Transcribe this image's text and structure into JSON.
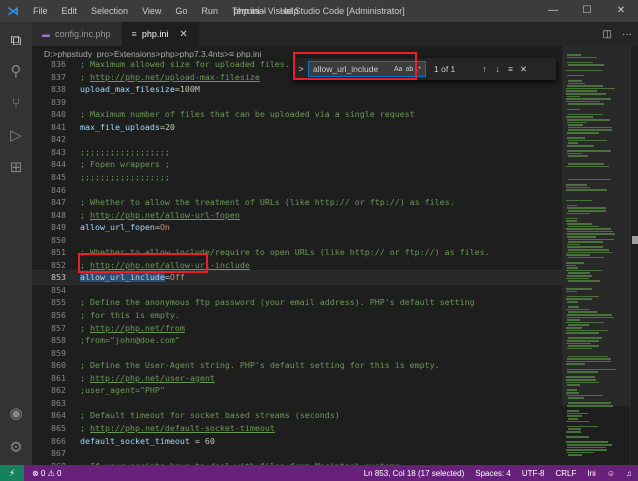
{
  "titlebar": {
    "logo": "⋊",
    "menu": [
      "File",
      "Edit",
      "Selection",
      "View",
      "Go",
      "Run",
      "Terminal",
      "Help"
    ],
    "title": "php.ini - Visual Studio Code [Administrator]",
    "minimize": "—",
    "maximize": "☐",
    "close": "✕"
  },
  "activity": {
    "explorer_icon": "⧉",
    "search_icon": "⚲",
    "scm_icon": "⑂",
    "debug_icon": "▷",
    "extensions_icon": "⊞",
    "account_icon": "◉",
    "settings_icon": "⚙"
  },
  "tabs": [
    {
      "icon": "php",
      "label": "config.inc.php",
      "active": false
    },
    {
      "icon": "≡",
      "label": "php.ini",
      "active": true,
      "close": "✕"
    }
  ],
  "tab_actions": {
    "split": "◫",
    "more": "···"
  },
  "breadcrumb": {
    "parts": [
      "D:",
      "phpstudy_pro",
      "Extensions",
      "php",
      "php7.3.4nts",
      "≡ php.ini"
    ],
    "separator": " > "
  },
  "find": {
    "toggle": ">",
    "query": "allow_url_include",
    "options": [
      "Aa",
      "ab",
      ".*"
    ],
    "count": "1 of 1",
    "prev": "↑",
    "next": "↓",
    "in_selection": "≡",
    "close": "✕"
  },
  "editor": {
    "current_line": 853,
    "lines": [
      {
        "n": "836",
        "segs": [
          [
            "cmt",
            "; Maximum allowed size for uploaded files."
          ]
        ]
      },
      {
        "n": "837",
        "segs": [
          [
            "cmt",
            "; "
          ],
          [
            "lnk",
            "http://php.net/upload-max-filesize"
          ]
        ]
      },
      {
        "n": "838",
        "segs": [
          [
            "key",
            "upload_max_filesize"
          ],
          [
            "op",
            "="
          ],
          [
            "val",
            "100M"
          ]
        ]
      },
      {
        "n": "839",
        "segs": []
      },
      {
        "n": "840",
        "segs": [
          [
            "cmt",
            "; Maximum number of files that can be uploaded via a single request"
          ]
        ]
      },
      {
        "n": "841",
        "segs": [
          [
            "key",
            "max_file_uploads"
          ],
          [
            "op",
            "="
          ],
          [
            "val",
            "20"
          ]
        ]
      },
      {
        "n": "842",
        "segs": []
      },
      {
        "n": "843",
        "segs": [
          [
            "cmt",
            ";;;;;;;;;;;;;;;;;;"
          ]
        ]
      },
      {
        "n": "844",
        "segs": [
          [
            "cmt",
            "; Fopen wrappers ;"
          ]
        ]
      },
      {
        "n": "845",
        "segs": [
          [
            "cmt",
            ";;;;;;;;;;;;;;;;;;"
          ]
        ]
      },
      {
        "n": "846",
        "segs": []
      },
      {
        "n": "847",
        "segs": [
          [
            "cmt",
            "; Whether to allow the treatment of URLs (like http:// or ftp://) as files."
          ]
        ]
      },
      {
        "n": "848",
        "segs": [
          [
            "cmt",
            "; "
          ],
          [
            "lnk",
            "http://php.net/allow-url-fopen"
          ]
        ]
      },
      {
        "n": "849",
        "segs": [
          [
            "key",
            "allow_url_fopen"
          ],
          [
            "op",
            "="
          ],
          [
            "str",
            "On"
          ]
        ]
      },
      {
        "n": "850",
        "segs": []
      },
      {
        "n": "851",
        "segs": [
          [
            "cmt",
            "; Whether to allow include/require to open URLs (like http:// or ftp://) as files."
          ]
        ]
      },
      {
        "n": "852",
        "segs": [
          [
            "cmt",
            "; "
          ],
          [
            "lnk",
            "http://php.net/allow-url-include"
          ]
        ]
      },
      {
        "n": "853",
        "segs": [
          [
            "sel",
            "allow_url_include"
          ],
          [
            "op",
            "="
          ],
          [
            "str",
            "Off"
          ]
        ]
      },
      {
        "n": "854",
        "segs": []
      },
      {
        "n": "855",
        "segs": [
          [
            "cmt",
            "; Define the anonymous ftp password (your email address). PHP's default setting"
          ]
        ]
      },
      {
        "n": "856",
        "segs": [
          [
            "cmt",
            "; for this is empty."
          ]
        ]
      },
      {
        "n": "857",
        "segs": [
          [
            "cmt",
            "; "
          ],
          [
            "lnk",
            "http://php.net/from"
          ]
        ]
      },
      {
        "n": "858",
        "segs": [
          [
            "cmt",
            ";from=\"john@doe.com\""
          ]
        ]
      },
      {
        "n": "859",
        "segs": []
      },
      {
        "n": "860",
        "segs": [
          [
            "cmt",
            "; Define the User-Agent string. PHP's default setting for this is empty."
          ]
        ]
      },
      {
        "n": "861",
        "segs": [
          [
            "cmt",
            "; "
          ],
          [
            "lnk",
            "http://php.net/user-agent"
          ]
        ]
      },
      {
        "n": "862",
        "segs": [
          [
            "cmt",
            ";user_agent=\"PHP\""
          ]
        ]
      },
      {
        "n": "863",
        "segs": []
      },
      {
        "n": "864",
        "segs": [
          [
            "cmt",
            "; Default timeout for socket based streams (seconds)"
          ]
        ]
      },
      {
        "n": "865",
        "segs": [
          [
            "cmt",
            "; "
          ],
          [
            "lnk",
            "http://php.net/default-socket-timeout"
          ]
        ]
      },
      {
        "n": "866",
        "segs": [
          [
            "key",
            "default_socket_timeout"
          ],
          [
            "op",
            " = "
          ],
          [
            "val",
            "60"
          ]
        ]
      },
      {
        "n": "867",
        "segs": []
      },
      {
        "n": "868",
        "segs": [
          [
            "cmt",
            "; If your scripts have to deal with files from Macintosh systems,"
          ]
        ]
      },
      {
        "n": "869",
        "segs": [
          [
            "cmt",
            "; or you are running on a Mac and need to deal with files from"
          ]
        ]
      },
      {
        "n": "870",
        "segs": [
          [
            "cmt",
            "; unix or win32 systems, setting this flag will cause PHP to"
          ]
        ]
      }
    ]
  },
  "statusbar": {
    "remote": "⚡",
    "problems": "⊗ 0 ⚠ 0",
    "position": "Ln 853, Col 18 (17 selected)",
    "spaces": "Spaces: 4",
    "encoding": "UTF-8",
    "eol": "CRLF",
    "language": "Ini",
    "feedback_icon": "☺",
    "bell_icon": "♫"
  },
  "colors": {
    "titlebar": "#3c3c3c",
    "editor_bg": "#1e1e1e",
    "statusbar": "#68217a",
    "comment": "#6a9955",
    "highlight_box": "#e8202a",
    "selection": "#264f78"
  }
}
